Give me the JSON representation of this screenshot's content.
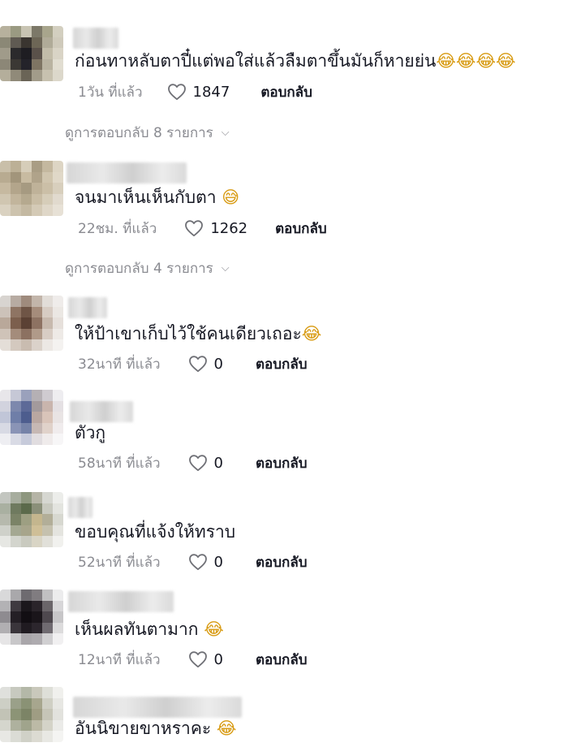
{
  "comments": [
    {
      "text": "ก่อนทาหลับตาปี๋แต่พอใส่แล้วลืมตาขึ้นมันก็หายย่น",
      "emoji": "😂😂😂😂",
      "time": "1วัน ที่แล้ว",
      "likes": "1847",
      "reply": "ตอบกลับ",
      "view_replies": "ดูการตอบกลับ 8 รายการ"
    },
    {
      "text": "จนมาเห็นเห็นกับตา",
      "emoji": "😅",
      "time": "22ชม. ที่แล้ว",
      "likes": "1262",
      "reply": "ตอบกลับ",
      "view_replies": "ดูการตอบกลับ 4 รายการ"
    },
    {
      "text": "ให้ป้าเขาเก็บไว้ใช้คนเดียวเถอะ",
      "emoji": "😂",
      "time": "32นาที ที่แล้ว",
      "likes": "0",
      "reply": "ตอบกลับ"
    },
    {
      "text": "ตัวกู",
      "emoji": "",
      "time": "58นาที ที่แล้ว",
      "likes": "0",
      "reply": "ตอบกลับ"
    },
    {
      "text": "ขอบคุณที่แจ้งให้ทราบ",
      "emoji": "",
      "time": "52นาที ที่แล้ว",
      "likes": "0",
      "reply": "ตอบกลับ"
    },
    {
      "text": "เห็นผลทันตามาก",
      "emoji": "😂",
      "time": "12นาที ที่แล้ว",
      "likes": "0",
      "reply": "ตอบกลับ"
    },
    {
      "text": "อันนิขายขาหราคะ",
      "emoji": "😂",
      "time": "",
      "likes": "",
      "reply": ""
    }
  ],
  "icons": {
    "like": "heart-outline-icon",
    "expand": "chevron-down-icon"
  },
  "colors": {
    "meta": "#8a8b91",
    "text": "#161823",
    "emoji": "#d89b13"
  }
}
